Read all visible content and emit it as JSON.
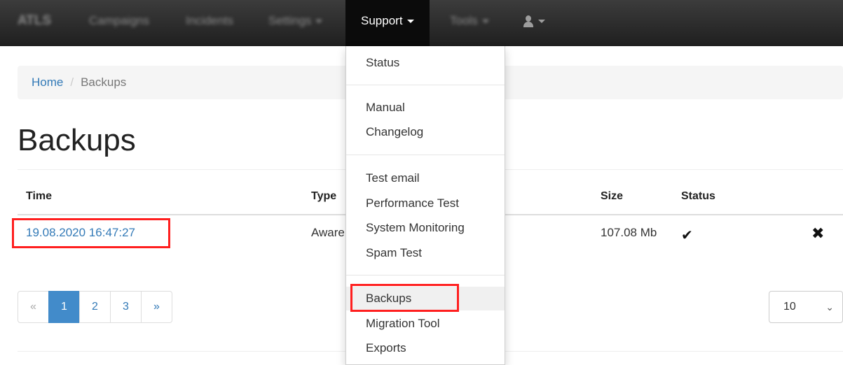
{
  "navbar": {
    "brand": "ATLS",
    "items": [
      "Campaigns",
      "Incidents",
      "Settings"
    ],
    "support_label": "Support",
    "tools_label": "Tools"
  },
  "breadcrumb": {
    "home": "Home",
    "separator": "/",
    "current": "Backups"
  },
  "page": {
    "title": "Backups"
  },
  "table": {
    "columns": {
      "time": "Time",
      "type": "Type",
      "size": "Size",
      "status": "Status"
    },
    "rows": [
      {
        "time": "19.08.2020 16:47:27",
        "type": "Aware",
        "size": "107.08 Mb",
        "status_icon": "check-icon",
        "action_icon": "delete-icon"
      }
    ]
  },
  "pagination": {
    "prev": "«",
    "pages": [
      "1",
      "2",
      "3"
    ],
    "next": "»",
    "current_page": 1
  },
  "page_size": {
    "value": "10"
  },
  "support_menu": {
    "groups": [
      [
        "Status"
      ],
      [
        "Manual",
        "Changelog"
      ],
      [
        "Test email",
        "Performance Test",
        "System Monitoring",
        "Spam Test"
      ],
      [
        "Backups",
        "Migration Tool",
        "Exports"
      ]
    ],
    "active_item": "Backups"
  },
  "colors": {
    "link": "#337ab7",
    "highlight": "#ff1f1f",
    "navbar": "#222222",
    "pagination_active": "#428bca"
  }
}
